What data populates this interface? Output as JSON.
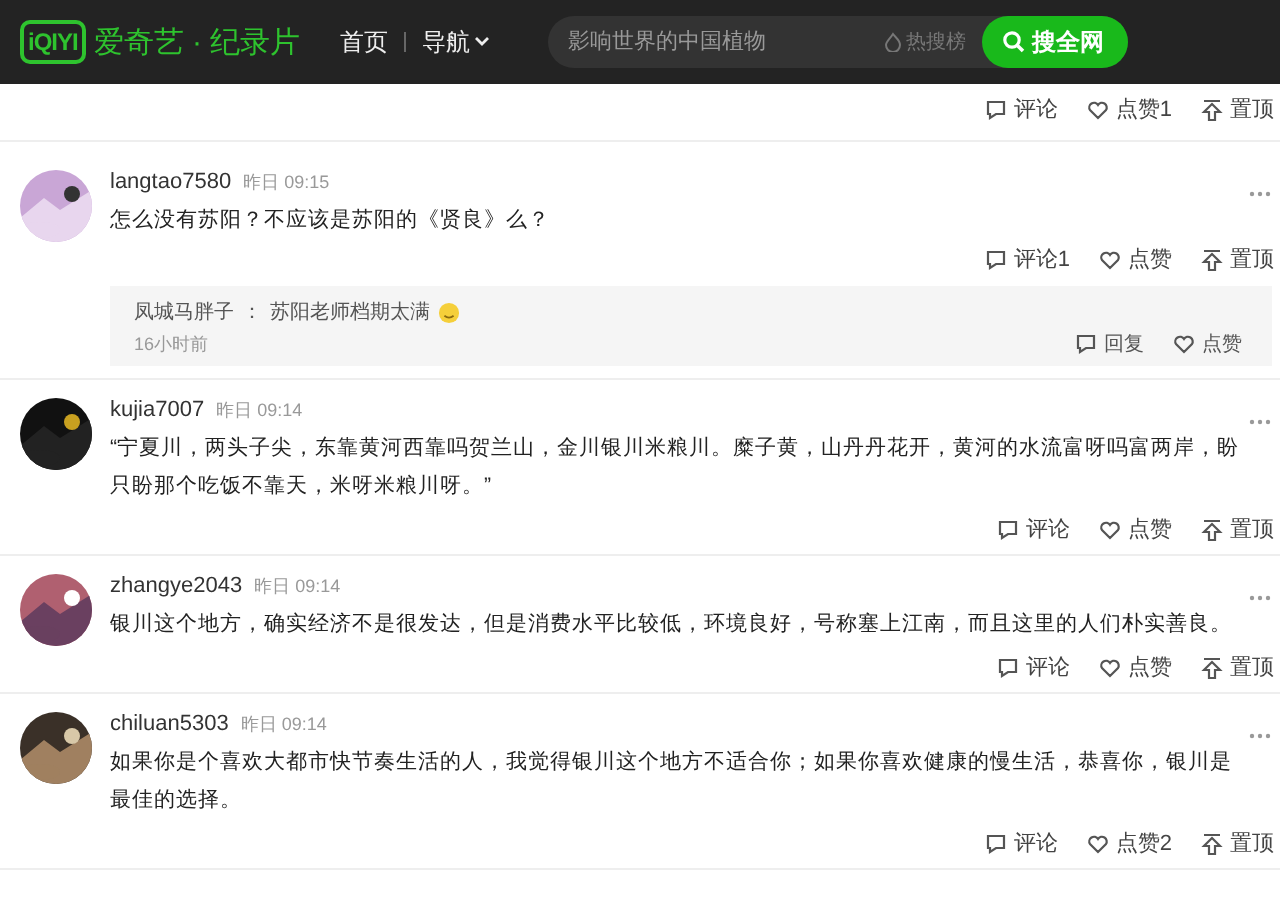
{
  "header": {
    "logo": "iQIYI",
    "brand": "爱奇艺",
    "section_separator": "·",
    "section": "纪录片",
    "nav": [
      {
        "label": "首页",
        "kind": "link"
      },
      {
        "label": "导航",
        "kind": "dropdown"
      }
    ],
    "search": {
      "placeholder": "影响世界的中国植物",
      "hot": "热搜榜",
      "button": "搜全网"
    }
  },
  "top_actions": [
    {
      "kind": "comment",
      "label": "评论"
    },
    {
      "kind": "like",
      "label": "点赞1"
    },
    {
      "kind": "top",
      "label": "置顶"
    }
  ],
  "comments": [
    {
      "user": "langtao7580",
      "time": "昨日 09:15",
      "text": "怎么没有苏阳？不应该是苏阳的《贤良》么？",
      "actions": [
        {
          "kind": "comment",
          "label": "评论1"
        },
        {
          "kind": "like",
          "label": "点赞"
        },
        {
          "kind": "top",
          "label": "置顶"
        }
      ],
      "replies": [
        {
          "user": "凤城马胖子",
          "separator": "：",
          "text": "苏阳老师档期太满",
          "emoji": true,
          "time": "16小时前",
          "actions": [
            {
              "kind": "reply",
              "label": "回复"
            },
            {
              "kind": "like",
              "label": "点赞"
            }
          ]
        }
      ]
    },
    {
      "user": "kujia7007",
      "time": "昨日 09:14",
      "text": "“宁夏川，两头子尖，东靠黄河西靠吗贺兰山，金川银川米粮川。糜子黄，山丹丹花开，黄河的水流富呀吗富两岸，盼只盼那个吃饭不靠天，米呀米粮川呀。”",
      "actions": [
        {
          "kind": "comment",
          "label": "评论"
        },
        {
          "kind": "like",
          "label": "点赞"
        },
        {
          "kind": "top",
          "label": "置顶"
        }
      ]
    },
    {
      "user": "zhangye2043",
      "time": "昨日 09:14",
      "text": "银川这个地方，确实经济不是很发达，但是消费水平比较低，环境良好，号称塞上江南，而且这里的人们朴实善良。",
      "actions": [
        {
          "kind": "comment",
          "label": "评论"
        },
        {
          "kind": "like",
          "label": "点赞"
        },
        {
          "kind": "top",
          "label": "置顶"
        }
      ]
    },
    {
      "user": "chiluan5303",
      "time": "昨日 09:14",
      "text": "如果你是个喜欢大都市快节奏生活的人，我觉得银川这个地方不适合你；如果你喜欢健康的慢生活，恭喜你，银川是最佳的选择。",
      "actions": [
        {
          "kind": "comment",
          "label": "评论"
        },
        {
          "kind": "like",
          "label": "点赞2"
        },
        {
          "kind": "top",
          "label": "置顶"
        }
      ]
    }
  ]
}
